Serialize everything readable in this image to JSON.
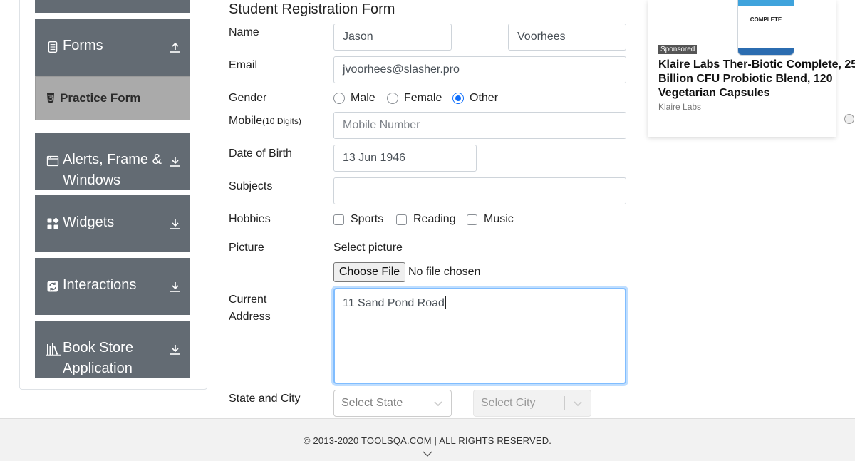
{
  "sidebar": {
    "groups": [
      {
        "label": "Forms",
        "icon": "form-icon",
        "arrow": "upload-arrow-icon"
      },
      {
        "label": "Alerts, Frame & Windows",
        "icon": "window-icon",
        "arrow": "download-arrow-icon"
      },
      {
        "label": "Widgets",
        "icon": "widgets-icon",
        "arrow": "download-arrow-icon"
      },
      {
        "label": "Interactions",
        "icon": "interactions-icon",
        "arrow": "download-arrow-icon"
      },
      {
        "label": "Book Store Application",
        "icon": "books-icon",
        "arrow": "download-arrow-icon"
      }
    ],
    "active_item": {
      "label": "Practice Form",
      "icon": "html5-icon"
    }
  },
  "form": {
    "title": "Student Registration Form",
    "name_label": "Name",
    "first_name": "Jason",
    "last_name": "Voorhees",
    "email_label": "Email",
    "email": "jvoorhees@slasher.pro",
    "gender_label": "Gender",
    "gender_options": [
      "Male",
      "Female",
      "Other"
    ],
    "gender_selected": "Other",
    "mobile_label": "Mobile",
    "mobile_hint": "(10 Digits)",
    "mobile_placeholder": "Mobile Number",
    "dob_label": "Date of Birth",
    "dob": "13 Jun 1946",
    "subjects_label": "Subjects",
    "hobbies_label": "Hobbies",
    "hobbies": [
      "Sports",
      "Reading",
      "Music"
    ],
    "picture_label": "Picture",
    "picture_prompt": "Select picture",
    "file_button": "Choose File",
    "file_status": "No file chosen",
    "address_label_1": "Current",
    "address_label_2": "Address",
    "address": "11 Sand Pond Road",
    "state_city_label": "State and City",
    "state_placeholder": "Select State",
    "city_placeholder": "Select City"
  },
  "ad": {
    "sponsored": "Sponsored",
    "title": "Klaire Labs Ther-Biotic Complete, 25 Billion CFU Probiotic Blend, 120 Vegetarian Capsules",
    "brand": "Klaire Labs",
    "bottle_text": "COMPLETE"
  },
  "footer": {
    "copyright": "© 2013-2020 TOOLSQA.COM | ALL RIGHTS RESERVED."
  },
  "colors": {
    "sidebar_group": "#636b73",
    "active_item": "#aaaaaa",
    "radio_accent": "#0d6efd",
    "focus_border": "#80bdff"
  }
}
